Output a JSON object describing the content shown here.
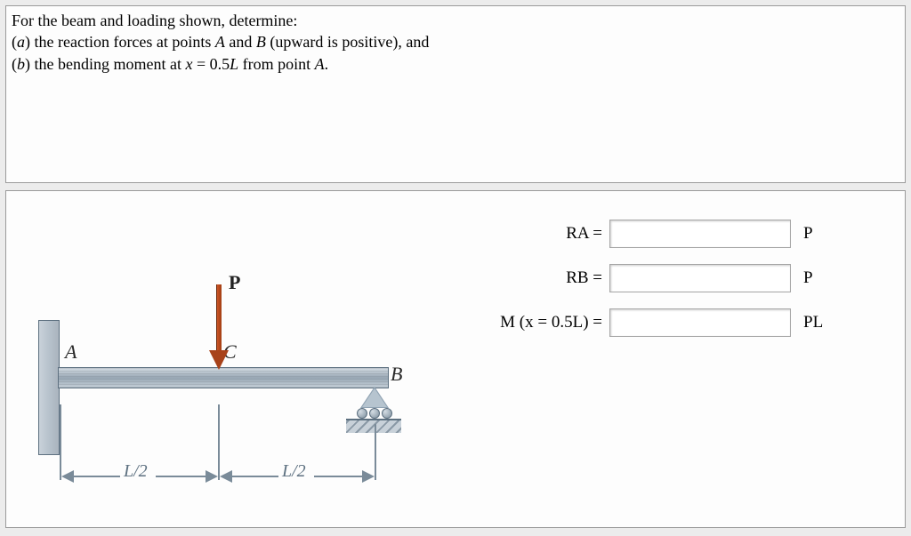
{
  "problem": {
    "line1": "For the beam and loading shown, determine:",
    "line2_prefix": "(",
    "line2_a": "a",
    "line2_text": ") the reaction forces at points ",
    "line2_A": "A",
    "line2_and": " and ",
    "line2_B": "B",
    "line2_suffix": " (upward is positive), and",
    "line3_prefix": "(",
    "line3_b": "b",
    "line3_text": ") the bending moment at ",
    "line3_x": "x",
    "line3_eq": " = 0.5",
    "line3_L": "L",
    "line3_suffix": " from point ",
    "line3_A": "A",
    "line3_end": "."
  },
  "diagram": {
    "label_A": "A",
    "label_B": "B",
    "label_C": "C",
    "label_P": "P",
    "dim_left": "L/2",
    "dim_right": "L/2"
  },
  "answers": {
    "rows": [
      {
        "label": "RA =",
        "value": "",
        "unit": "P"
      },
      {
        "label": "RB =",
        "value": "",
        "unit": "P"
      },
      {
        "label": "M (x = 0.5L) =",
        "value": "",
        "unit": "PL"
      }
    ]
  }
}
